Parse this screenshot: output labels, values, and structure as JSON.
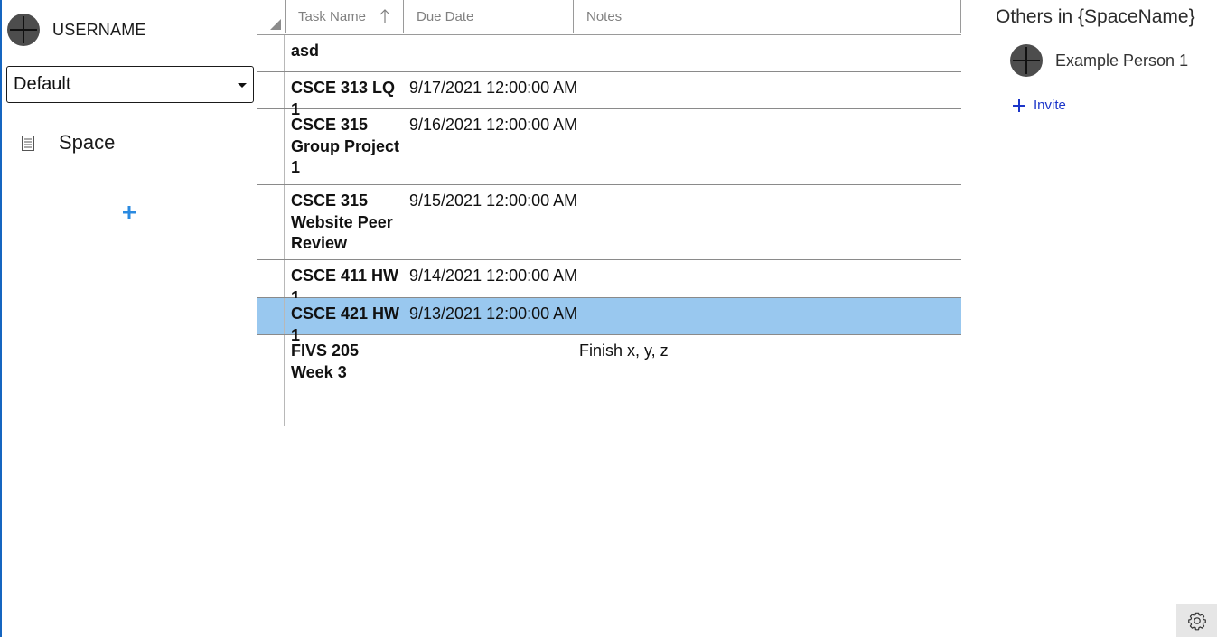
{
  "user": {
    "name": "USERNAME"
  },
  "space_select": {
    "selected": "Default"
  },
  "sidebar": {
    "items": [
      {
        "label": "Space",
        "icon": "document-icon"
      }
    ],
    "add_icon": "plus-icon"
  },
  "grid": {
    "columns": [
      {
        "label": "Task Name",
        "sorted": "ascending"
      },
      {
        "label": "Due Date"
      },
      {
        "label": "Notes"
      }
    ],
    "rows": [
      {
        "name": "asd",
        "due": "",
        "notes": ""
      },
      {
        "name": "CSCE 313 LQ 1",
        "due": "9/17/2021 12:00:00 AM",
        "notes": ""
      },
      {
        "name": "CSCE 315 Group Project 1",
        "due": "9/16/2021 12:00:00 AM",
        "notes": ""
      },
      {
        "name": "CSCE 315 Website Peer Review",
        "due": "9/15/2021 12:00:00 AM",
        "notes": ""
      },
      {
        "name": "CSCE 411 HW 1",
        "due": "9/14/2021 12:00:00 AM",
        "notes": ""
      },
      {
        "name": "CSCE 421 HW 1",
        "due": "9/13/2021 12:00:00 AM",
        "notes": "",
        "selected": true
      },
      {
        "name": "FIVS 205 Week 3",
        "due": "",
        "notes": "Finish x, y, z"
      },
      {
        "name": "",
        "due": "",
        "notes": ""
      }
    ]
  },
  "others": {
    "title": "Others in {SpaceName}",
    "people": [
      {
        "name": "Example Person 1"
      }
    ],
    "invite_label": "Invite"
  },
  "colors": {
    "accent": "#1565c0",
    "selected_row": "#99c8ef",
    "link": "#1b35c9",
    "add_icon": "#2a8ae0"
  },
  "footer": {
    "settings_icon": "gear-icon"
  }
}
